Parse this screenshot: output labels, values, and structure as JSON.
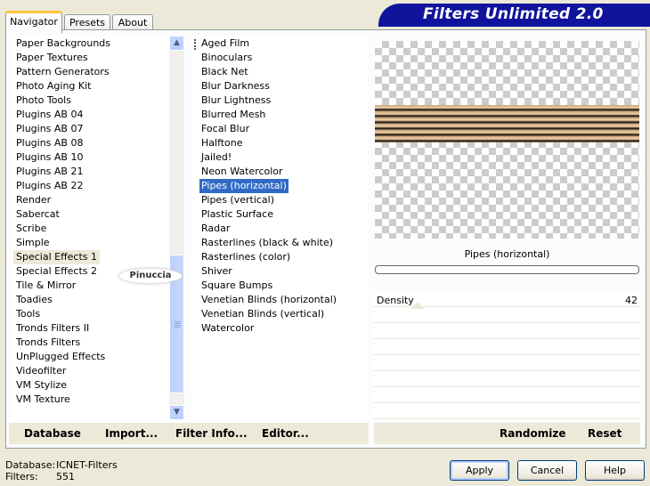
{
  "tabs": [
    "Navigator",
    "Presets",
    "About"
  ],
  "active_tab": "Navigator",
  "app_title": "Filters Unlimited 2.0",
  "categories": [
    "Paper Backgrounds",
    "Paper Textures",
    "Pattern Generators",
    "Photo Aging Kit",
    "Photo Tools",
    "Plugins AB 04",
    "Plugins AB 07",
    "Plugins AB 08",
    "Plugins AB 10",
    "Plugins AB 21",
    "Plugins AB 22",
    "Render",
    "Sabercat",
    "Scribe",
    "Simple",
    "Special Effects 1",
    "Special Effects 2",
    "Tile & Mirror",
    "Toadies",
    "Tools",
    "Tronds Filters II",
    "Tronds Filters",
    "UnPlugged Effects",
    "Videofilter",
    "VM Stylize",
    "VM Texture"
  ],
  "selected_category": "Special Effects 1",
  "filters": [
    "Aged Film",
    "Binoculars",
    "Black Net",
    "Blur Darkness",
    "Blur Lightness",
    "Blurred Mesh",
    "Focal Blur",
    "Halftone",
    "Jailed!",
    "Neon Watercolor",
    "Pipes (horizontal)",
    "Pipes (vertical)",
    "Plastic Surface",
    "Radar",
    "Rasterlines (black & white)",
    "Rasterlines (color)",
    "Shiver",
    "Square Bumps",
    "Venetian Blinds (horizontal)",
    "Venetian Blinds (vertical)",
    "Watercolor"
  ],
  "selected_filter": "Pipes (horizontal)",
  "preview": {
    "filter_name": "Pipes (horizontal)"
  },
  "params": {
    "density_label": "Density",
    "density_value": "42"
  },
  "toolbar": {
    "database": "Database",
    "import": "Import...",
    "filter_info": "Filter Info...",
    "editor": "Editor...",
    "randomize": "Randomize",
    "reset": "Reset"
  },
  "status": {
    "database_label": "Database:",
    "database_value": "ICNET-Filters",
    "filters_label": "Filters:",
    "filters_value": "551"
  },
  "buttons": {
    "apply": "Apply",
    "cancel": "Cancel",
    "help": "Help"
  },
  "watermark": "Pinuccia",
  "colors": {
    "banner": "#10149c",
    "selection": "#316ac5",
    "window": "#ece9d8"
  }
}
